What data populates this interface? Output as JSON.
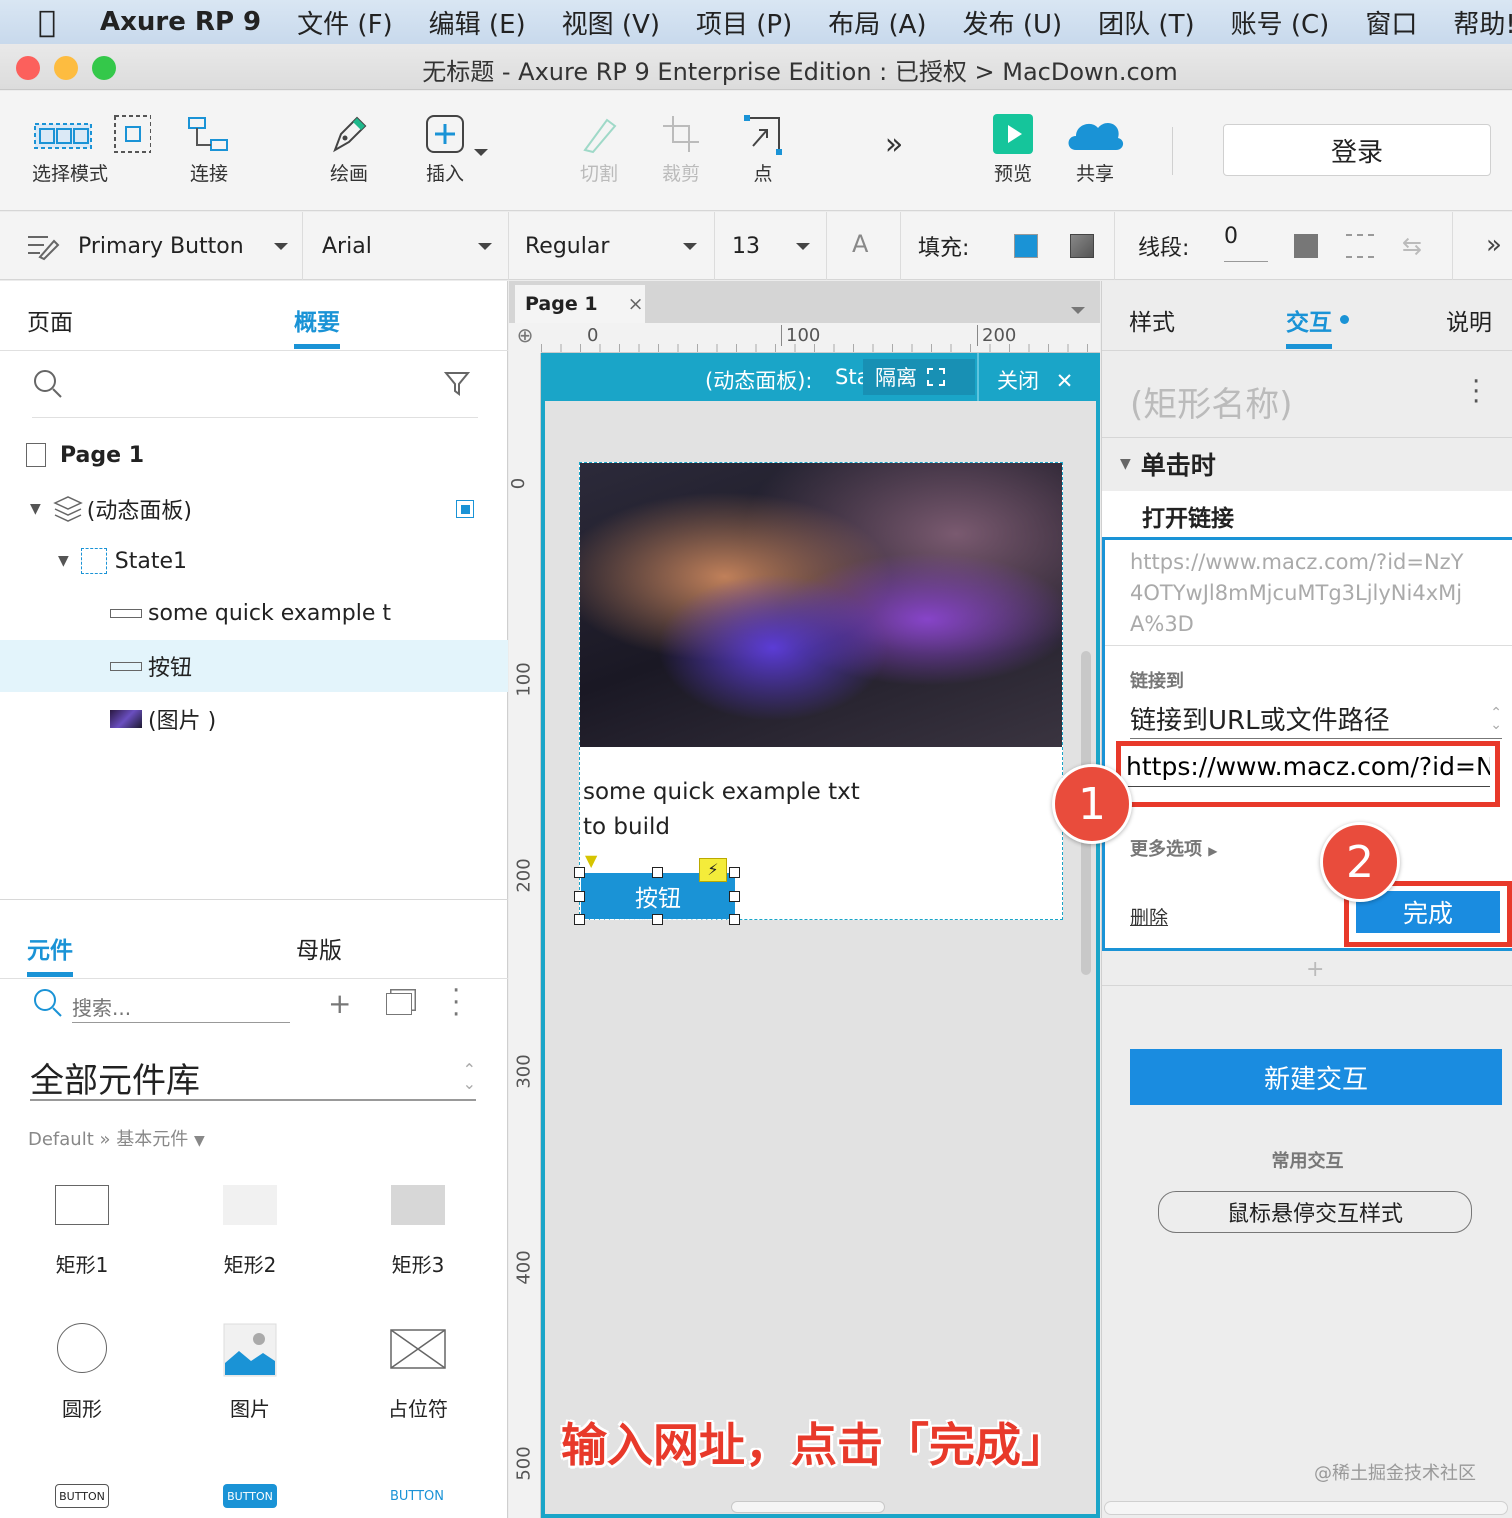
{
  "menubar": {
    "app_name": "Axure RP 9",
    "items": [
      "文件 (F)",
      "编辑 (E)",
      "视图 (V)",
      "项目 (P)",
      "布局 (A)",
      "发布 (U)",
      "团队 (T)",
      "账号 (C)",
      "窗口",
      "帮助!"
    ]
  },
  "window": {
    "title": "无标题 - Axure RP 9 Enterprise Edition : 已授权 > MacDown.com"
  },
  "toolbar": {
    "select_mode": "选择模式",
    "connect": "连接",
    "draw": "绘画",
    "insert": "插入",
    "cut": "切割",
    "crop": "裁剪",
    "point": "点",
    "more": "»",
    "preview": "预览",
    "share": "共享",
    "login": "登录"
  },
  "stylebar": {
    "style_name": "Primary Button",
    "font_family": "Arial",
    "font_weight": "Regular",
    "font_size": "13",
    "font_color_glyph": "A",
    "fill_label": "填充:",
    "fill_color": "#1a93d6",
    "line_label": "线段:",
    "line_width": "0"
  },
  "left_panel": {
    "tabs": [
      "页面",
      "概要"
    ],
    "active_tab": "概要",
    "outline": {
      "page": "Page 1",
      "dynamic_panel": "(动态面板)",
      "state": "State1",
      "text_item": "some quick example t",
      "button_item": "按钮",
      "image_item": "(图片 )"
    },
    "widgets_tabs": [
      "元件",
      "母版"
    ],
    "search_placeholder": "搜索...",
    "library": "全部元件库",
    "breadcrumb": "Default » 基本元件",
    "widgets": [
      "矩形1",
      "矩形2",
      "矩形3",
      "圆形",
      "图片",
      "占位符"
    ],
    "button_samples": [
      "BUTTON",
      "BUTTON",
      "BUTTON"
    ]
  },
  "canvas": {
    "tab": "Page 1",
    "ruler_h": [
      "0",
      "100",
      "200"
    ],
    "ruler_v": [
      "0",
      "100",
      "200",
      "300",
      "400",
      "500"
    ],
    "panel_bar_label": "(动态面板):",
    "panel_bar_state": "State1",
    "panel_bar_isolate": "隔离",
    "panel_bar_close": "关闭",
    "card_text_line1": "some quick example txt",
    "card_text_line2": "to build",
    "button_label": "按钮",
    "caption": "输入网址，点击「完成」"
  },
  "right_panel": {
    "tabs": [
      "样式",
      "交互",
      "说明"
    ],
    "active_tab": "交互",
    "shape_name_placeholder": "(矩形名称)",
    "event": "单击时",
    "action": "打开链接",
    "url_preview": "https://www.macz.com/?id=NzY4OTYwJl8mMjcuMTg3LjlyNi4xMjA%3D",
    "link_to_label": "链接到",
    "link_to_value": "链接到URL或文件路径",
    "url_input": "https://www.macz.com/?id=N",
    "more_options": "更多选项",
    "delete": "删除",
    "done": "完成",
    "new_interaction": "新建交互",
    "common_label": "常用交互",
    "hover_style": "鼠标悬停交互样式",
    "watermark": "@稀土掘金技术社区"
  },
  "annotations": [
    "1",
    "2"
  ]
}
